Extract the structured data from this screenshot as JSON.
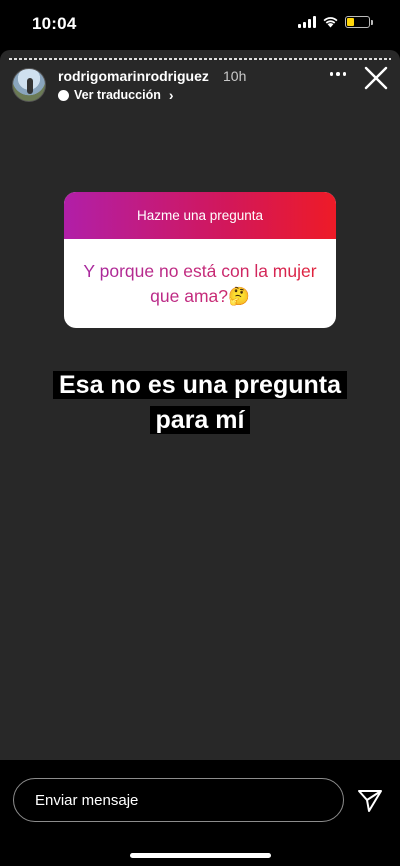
{
  "status_bar": {
    "time": "10:04",
    "battery_color": "#ffd60a",
    "battery_level": 0.35
  },
  "story": {
    "username": "rodrigomarinrodriguez",
    "time_ago": "10h",
    "translate_label": "Ver traducción",
    "translate_chevron": "›",
    "question_sticker": {
      "title": "Hazme una pregunta",
      "question": "Y porque no está con la mujer que ama?",
      "emoji": "🤔"
    },
    "answer": {
      "line1": "Esa no es una pregunta",
      "line2": "para mí"
    }
  },
  "reply": {
    "placeholder": "Enviar mensaje"
  },
  "icons": {
    "more": "more-horizontal-icon",
    "close": "close-icon",
    "send": "send-icon"
  }
}
